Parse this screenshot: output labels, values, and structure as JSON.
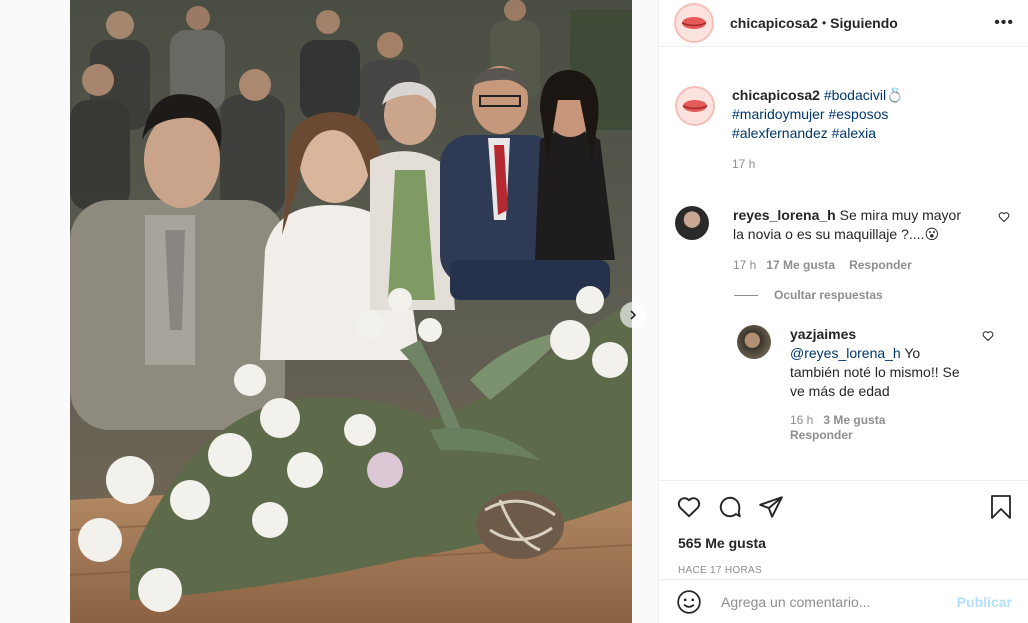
{
  "post": {
    "username": "chicapicosa2",
    "separator": "•",
    "follow_status": "Siguiendo",
    "more_label": "•••"
  },
  "caption": {
    "username": "chicapicosa2",
    "tags": [
      "#bodacivil💍",
      "#maridoymujer",
      "#esposos",
      "#alexfernandez",
      "#alexia"
    ],
    "time": "17 h"
  },
  "comments": [
    {
      "username": "reyes_lorena_h",
      "text": "Se mira muy mayor la novia o es su maquillaje ?....😮",
      "time": "17 h",
      "likes": "17 Me gusta",
      "reply_label": "Responder"
    }
  ],
  "hide_replies_label": "Ocultar respuestas",
  "replies": [
    {
      "username": "yazjaimes",
      "mention": "@reyes_lorena_h",
      "text": "Yo también noté lo mismo!! Se ve más de edad",
      "time": "16 h",
      "likes": "3 Me gusta",
      "reply_label": "Responder"
    }
  ],
  "actions": {
    "like_icon": "heart-icon",
    "comment_icon": "comment-icon",
    "share_icon": "share-icon",
    "save_icon": "bookmark-icon"
  },
  "likes_count": "565 Me gusta",
  "posted_ago": "HACE 17 HORAS",
  "add_comment": {
    "placeholder": "Agrega un comentario...",
    "publish_label": "Publicar"
  },
  "colors": {
    "link": "#00376b",
    "muted": "#8e8e8e",
    "publish_disabled": "#b2dffc",
    "border": "#efefef"
  }
}
